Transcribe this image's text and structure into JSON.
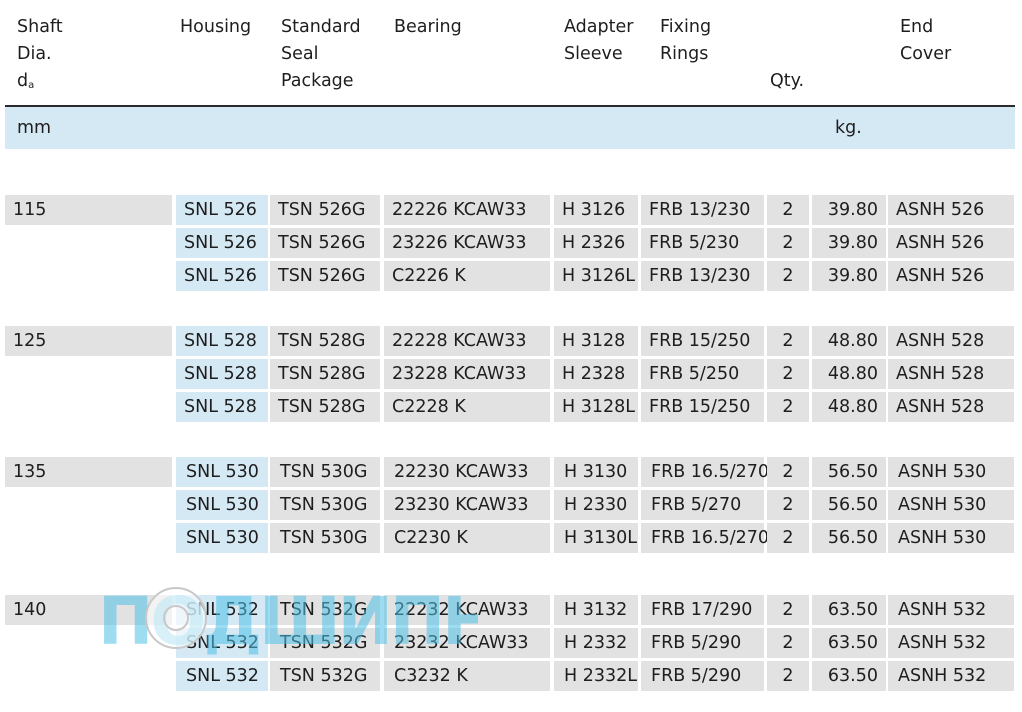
{
  "headers": {
    "shaft": [
      "Shaft",
      "Dia.",
      "d",
      "a"
    ],
    "housing": "Housing",
    "seal": [
      "Standard",
      "Seal",
      "Package"
    ],
    "bearing": "Bearing",
    "adapter": [
      "Adapter",
      "Sleeve"
    ],
    "fixing": [
      "Fixing",
      "Rings"
    ],
    "qty": "Qty.",
    "endcover": [
      "End",
      "Cover"
    ]
  },
  "units": {
    "shaft": "mm",
    "weight": "kg."
  },
  "watermark": "ПОДШИПНИКЪ",
  "groups": [
    {
      "dia": "115",
      "rows": [
        [
          "SNL 526",
          "TSN 526G",
          "22226 KCAW33",
          "H 3126",
          "FRB 13/230",
          "2",
          "39.80",
          "ASNH 526"
        ],
        [
          "SNL 526",
          "TSN 526G",
          "23226 KCAW33",
          "H 2326",
          "FRB 5/230",
          "2",
          "39.80",
          "ASNH 526"
        ],
        [
          "SNL 526",
          "TSN 526G",
          "C2226 K",
          "H 3126L",
          "FRB 13/230",
          "2",
          "39.80",
          "ASNH 526"
        ]
      ]
    },
    {
      "dia": "125",
      "rows": [
        [
          "SNL 528",
          "TSN 528G",
          "22228 KCAW33",
          "H 3128",
          "FRB 15/250",
          "2",
          "48.80",
          "ASNH 528"
        ],
        [
          "SNL 528",
          "TSN 528G",
          "23228 KCAW33",
          "H 2328",
          "FRB 5/250",
          "2",
          "48.80",
          "ASNH 528"
        ],
        [
          "SNL 528",
          "TSN 528G",
          "C2228 K",
          "H 3128L",
          "FRB 15/250",
          "2",
          "48.80",
          "ASNH 528"
        ]
      ]
    },
    {
      "dia": "135",
      "rows": [
        [
          "SNL 530",
          "TSN 530G",
          "22230 KCAW33",
          "H 3130",
          "FRB 16.5/270",
          "2",
          "56.50",
          "ASNH 530"
        ],
        [
          "SNL 530",
          "TSN 530G",
          "23230 KCAW33",
          "H 2330",
          "FRB 5/270",
          "2",
          "56.50",
          "ASNH 530"
        ],
        [
          "SNL 530",
          "TSN 530G",
          "C2230 K",
          "H 3130L",
          "FRB 16.5/270",
          "2",
          "56.50",
          "ASNH 530"
        ]
      ]
    },
    {
      "dia": "140",
      "rows": [
        [
          "SNL 532",
          "TSN 532G",
          "22232 KCAW33",
          "H 3132",
          "FRB 17/290",
          "2",
          "63.50",
          "ASNH 532"
        ],
        [
          "SNL 532",
          "TSN 532G",
          "23232 KCAW33",
          "H 2332",
          "FRB 5/290",
          "2",
          "63.50",
          "ASNH 532"
        ],
        [
          "SNL 532",
          "TSN 532G",
          "C3232 K",
          "H 2332L",
          "FRB 5/290",
          "2",
          "63.50",
          "ASNH 532"
        ]
      ]
    }
  ]
}
